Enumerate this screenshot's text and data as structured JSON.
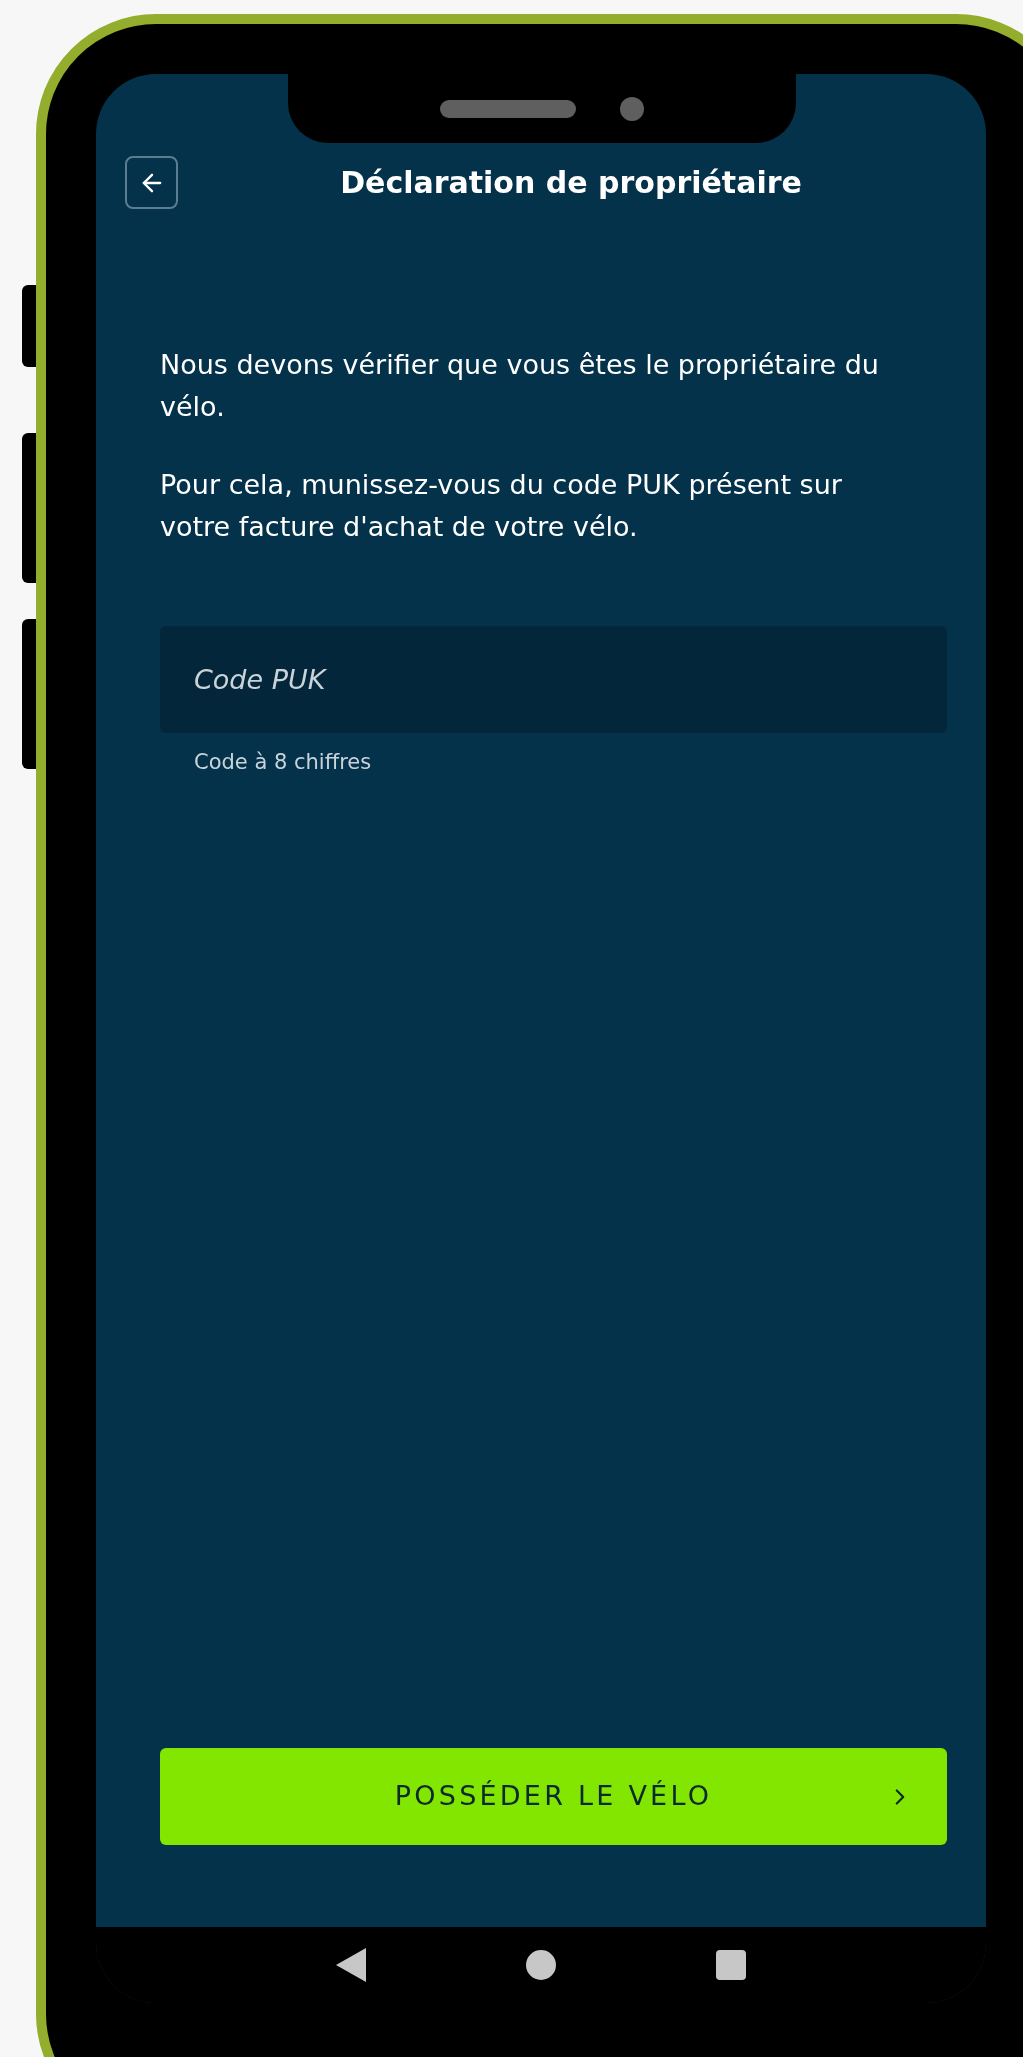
{
  "header": {
    "title": "Déclaration de propriétaire"
  },
  "paragraphs": [
    "Nous devons vérifier que vous êtes le propriétaire du vélo.",
    "Pour cela, munissez-vous du code PUK présent sur votre facture d'achat de votre vélo."
  ],
  "puk_field": {
    "placeholder": "Code PUK",
    "helper": "Code à 8 chiffres"
  },
  "primary_button": {
    "label": "POSSÉDER LE VÉLO"
  }
}
